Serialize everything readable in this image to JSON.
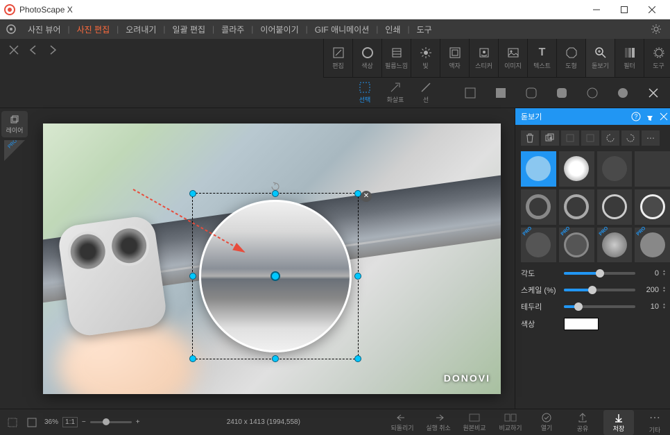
{
  "window": {
    "title": "PhotoScape X"
  },
  "menu": {
    "items": [
      "사진 뷰어",
      "사진 편집",
      "오려내기",
      "일괄 편집",
      "콜라주",
      "이어붙이기",
      "GIF 애니메이션",
      "인쇄",
      "도구"
    ],
    "active_index": 1
  },
  "toolbar": [
    {
      "id": "edit",
      "label": "편집"
    },
    {
      "id": "color",
      "label": "색상"
    },
    {
      "id": "film",
      "label": "필름느낌"
    },
    {
      "id": "light",
      "label": "빛"
    },
    {
      "id": "frame",
      "label": "액자"
    },
    {
      "id": "sticker",
      "label": "스티커"
    },
    {
      "id": "image",
      "label": "이미지"
    },
    {
      "id": "text",
      "label": "텍스트"
    },
    {
      "id": "shape",
      "label": "도형"
    },
    {
      "id": "magnifier",
      "label": "돋보기"
    },
    {
      "id": "filter",
      "label": "필터"
    },
    {
      "id": "tools",
      "label": "도구"
    }
  ],
  "subtools": {
    "left": [
      {
        "id": "select",
        "label": "선택",
        "selected": true
      },
      {
        "id": "arrow",
        "label": "화살표",
        "selected": false
      },
      {
        "id": "line",
        "label": "선",
        "selected": false
      }
    ]
  },
  "layer_tab": "레이어",
  "panel": {
    "title": "돋보기",
    "sliders": {
      "angle": {
        "label": "각도",
        "value": 0,
        "pct": 50
      },
      "scale": {
        "label": "스케일 (%)",
        "value": 200,
        "pct": 40
      },
      "border": {
        "label": "테두리",
        "value": 10,
        "pct": 20
      }
    },
    "color": {
      "label": "색상",
      "value": "#ffffff"
    }
  },
  "status": {
    "zoom_pct": "36%",
    "zoom_11": "1:1",
    "dims": "2410 x 1413 (1994,558)"
  },
  "actions": {
    "undo": "되돌리기",
    "redo": "실행 취소",
    "open": "열기",
    "compare": "원본비교",
    "compareside": "비교하기",
    "share": "공유",
    "save": "저장",
    "more": "기타"
  },
  "watermark": "DONOVI"
}
